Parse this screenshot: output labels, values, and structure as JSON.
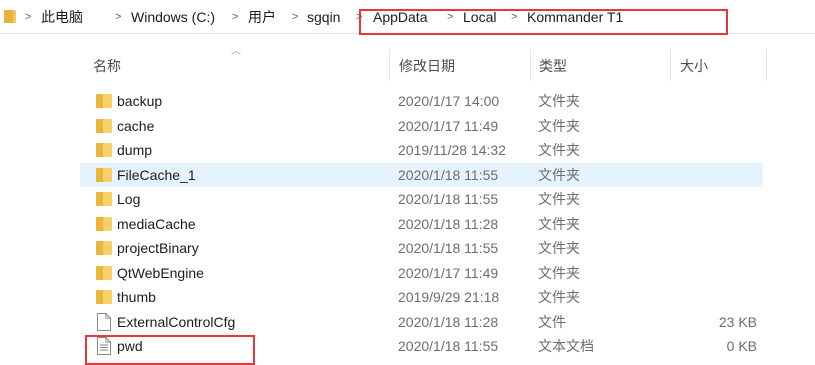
{
  "breadcrumbs": [
    "此电脑",
    "Windows (C:)",
    "用户",
    "sgqin",
    "AppData",
    "Local",
    "Kommander T1"
  ],
  "columns": {
    "name": "名称",
    "date": "修改日期",
    "type": "类型",
    "size": "大小"
  },
  "rows": [
    {
      "name": "backup",
      "date": "2020/1/17 14:00",
      "type": "文件夹",
      "size": "",
      "icon": "folder-icon"
    },
    {
      "name": "cache",
      "date": "2020/1/17 11:49",
      "type": "文件夹",
      "size": "",
      "icon": "folder-icon"
    },
    {
      "name": "dump",
      "date": "2019/11/28 14:32",
      "type": "文件夹",
      "size": "",
      "icon": "folder-icon"
    },
    {
      "name": "FileCache_1",
      "date": "2020/1/18 11:55",
      "type": "文件夹",
      "size": "",
      "icon": "folder-icon"
    },
    {
      "name": "Log",
      "date": "2020/1/18 11:55",
      "type": "文件夹",
      "size": "",
      "icon": "folder-icon"
    },
    {
      "name": "mediaCache",
      "date": "2020/1/18 11:28",
      "type": "文件夹",
      "size": "",
      "icon": "folder-icon"
    },
    {
      "name": "projectBinary",
      "date": "2020/1/18 11:55",
      "type": "文件夹",
      "size": "",
      "icon": "folder-icon"
    },
    {
      "name": "QtWebEngine",
      "date": "2020/1/17 11:49",
      "type": "文件夹",
      "size": "",
      "icon": "folder-icon"
    },
    {
      "name": "thumb",
      "date": "2019/9/29 21:18",
      "type": "文件夹",
      "size": "",
      "icon": "folder-icon"
    },
    {
      "name": "ExternalControlCfg",
      "date": "2020/1/18 11:28",
      "type": "文件",
      "size": "23 KB",
      "icon": "file-icon"
    },
    {
      "name": "pwd",
      "date": "2020/1/18 11:55",
      "type": "文本文档",
      "size": "0 KB",
      "icon": "text-file-icon"
    }
  ],
  "colors": {
    "highlight_box": "#e3393e",
    "selected_row": "#e5f3ff",
    "folder": "#f6d167"
  }
}
